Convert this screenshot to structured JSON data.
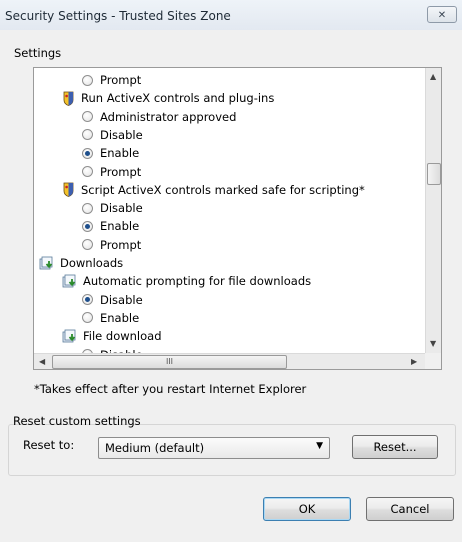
{
  "window": {
    "title": "Security Settings - Trusted Sites Zone",
    "close_glyph": "✕"
  },
  "settings_group": {
    "legend": "Settings",
    "tree": [
      {
        "kind": "radio",
        "label": "Prompt",
        "checked": false
      },
      {
        "kind": "category",
        "icon": "shield-setting-icon",
        "label": "Run ActiveX controls and plug-ins"
      },
      {
        "kind": "radio",
        "label": "Administrator approved",
        "checked": false
      },
      {
        "kind": "radio",
        "label": "Disable",
        "checked": false
      },
      {
        "kind": "radio",
        "label": "Enable",
        "checked": true
      },
      {
        "kind": "radio",
        "label": "Prompt",
        "checked": false
      },
      {
        "kind": "category",
        "icon": "shield-setting-icon",
        "label": "Script ActiveX controls marked safe for scripting*"
      },
      {
        "kind": "radio",
        "label": "Disable",
        "checked": false
      },
      {
        "kind": "radio",
        "label": "Enable",
        "checked": true
      },
      {
        "kind": "radio",
        "label": "Prompt",
        "checked": false
      },
      {
        "kind": "section",
        "icon": "downloads-icon",
        "label": "Downloads"
      },
      {
        "kind": "category",
        "icon": "downloads-icon",
        "label": "Automatic prompting for file downloads"
      },
      {
        "kind": "radio",
        "label": "Disable",
        "checked": true
      },
      {
        "kind": "radio",
        "label": "Enable",
        "checked": false
      },
      {
        "kind": "category",
        "icon": "downloads-icon",
        "label": "File download"
      },
      {
        "kind": "radio",
        "label": "Disable",
        "checked": false
      }
    ],
    "scroll_thumb_glyph": "III",
    "footnote": "*Takes effect after you restart Internet Explorer"
  },
  "reset_group": {
    "legend": "Reset custom settings",
    "reset_to_label": "Reset to:",
    "selected_level": "Medium (default)",
    "reset_button": "Reset..."
  },
  "buttons": {
    "ok": "OK",
    "cancel": "Cancel"
  },
  "colors": {
    "radio_dot": "#1e4f8c",
    "default_button_border": "#3c7fb1"
  }
}
